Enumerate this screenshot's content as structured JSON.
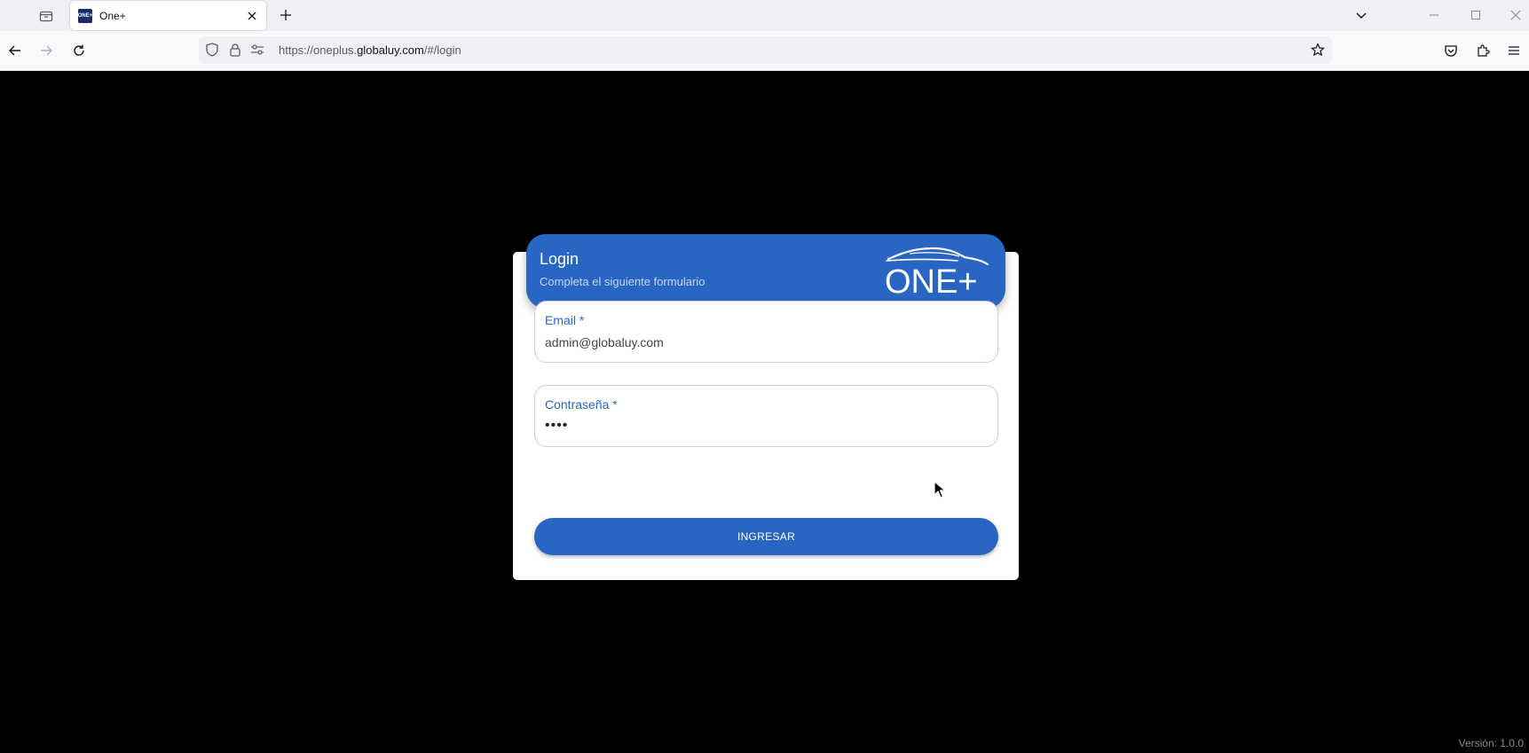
{
  "browser": {
    "tab_title": "One+",
    "tab_favicon_text": "ONE+",
    "url_prefix": "https://oneplus.",
    "url_host": "globaluy.com",
    "url_path": "/#/login"
  },
  "login": {
    "title": "Login",
    "subtitle": "Completa el siguiente formulario",
    "logo_text": "ONE+",
    "email_label": "Email *",
    "email_value": "admin@globaluy.com",
    "password_label": "Contraseña *",
    "password_value": "••••",
    "submit_label": "INGRESAR"
  },
  "footer": {
    "version": "Versión: 1.0.0"
  },
  "colors": {
    "accent": "#2965c2",
    "page_background": "#000000",
    "card_background": "#ffffff"
  }
}
